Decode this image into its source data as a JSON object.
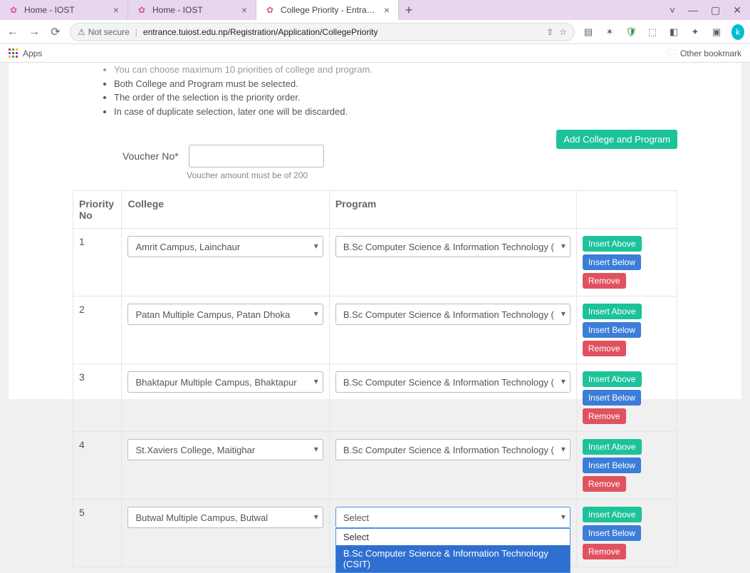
{
  "browser": {
    "tabs": [
      {
        "title": "Home - IOST"
      },
      {
        "title": "Home - IOST"
      },
      {
        "title": "College Priority - Entrance Regis"
      }
    ],
    "newtab_label": "+",
    "window_controls": {
      "min": "—",
      "max": "▢",
      "close": "✕",
      "caret": "˅"
    },
    "nav": {
      "back": "←",
      "forward": "→",
      "reload": "⟳"
    },
    "security_label": "Not secure",
    "url": "entrance.tuiost.edu.np/Registration/Application/CollegePriority",
    "toolbar_icons": {
      "share": "⇪",
      "star": "☆",
      "ext1": "▤",
      "ext2": "✶",
      "shield": "🛡",
      "cube": "⬚",
      "ext3": "◧",
      "puzzle": "✦",
      "tabs": "▣"
    },
    "avatar_letter": "k",
    "apps_label": "Apps",
    "other_bookmarks": "Other bookmark"
  },
  "instructions": [
    "You can choose maximum 10 priorities of college and program.",
    "Both College and Program must be selected.",
    "The order of the selection is the priority order.",
    "In case of duplicate selection, later one will be discarded."
  ],
  "add_button": "Add College and Program",
  "voucher": {
    "label": "Voucher No*",
    "value": "",
    "hint": "Voucher amount must be of 200"
  },
  "columns": {
    "priority": "Priority No",
    "college": "College",
    "program": "Program"
  },
  "action_labels": {
    "insert_above": "Insert Above",
    "insert_below": "Insert Below",
    "remove": "Remove"
  },
  "rows": [
    {
      "no": "1",
      "college": "Amrit Campus, Lainchaur",
      "program": "B.Sc Computer Science & Information Technology (",
      "open": false
    },
    {
      "no": "2",
      "college": "Patan Multiple Campus, Patan Dhoka",
      "program": "B.Sc Computer Science & Information Technology (",
      "open": false
    },
    {
      "no": "3",
      "college": "Bhaktapur Multiple Campus, Bhaktapur",
      "program": "B.Sc Computer Science & Information Technology (",
      "open": false
    },
    {
      "no": "4",
      "college": "St.Xaviers College, Maitighar",
      "program": "B.Sc Computer Science & Information Technology (",
      "open": false
    },
    {
      "no": "5",
      "college": "Butwal Multiple Campus, Butwal",
      "program": "Select",
      "open": true
    }
  ],
  "dropdown_options": [
    {
      "label": "Select",
      "highlight": false
    },
    {
      "label": "B.Sc Computer Science & Information Technology (CSIT)",
      "highlight": true
    }
  ]
}
